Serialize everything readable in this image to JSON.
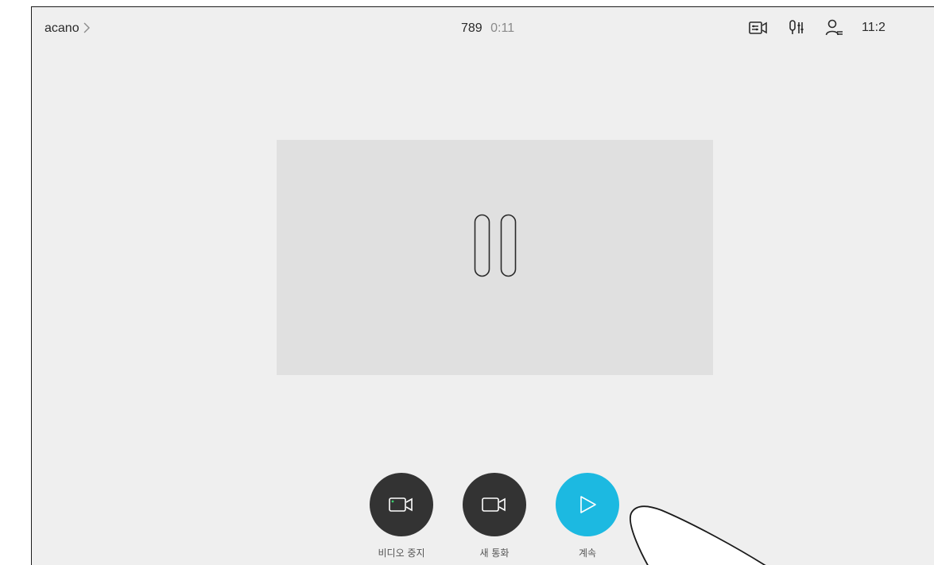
{
  "header": {
    "call_name": "acano",
    "call_number": "789",
    "call_duration": "0:11",
    "clock": "11:2",
    "icons": [
      "camera-control-icon",
      "audio-settings-icon",
      "participants-icon"
    ]
  },
  "main": {
    "state": "on-hold",
    "icon": "pause-icon"
  },
  "controls": [
    {
      "label": "비디오 중지",
      "icon": "video-camera-icon",
      "style": "dark"
    },
    {
      "label": "새 통화",
      "icon": "video-camera-icon",
      "style": "dark"
    },
    {
      "label": "계속",
      "icon": "play-icon",
      "style": "accent"
    }
  ],
  "colors": {
    "background": "#efefef",
    "tile": "#e0e0e0",
    "dark_button": "#333333",
    "accent": "#1cb9e1",
    "led": "#3bd16f"
  }
}
